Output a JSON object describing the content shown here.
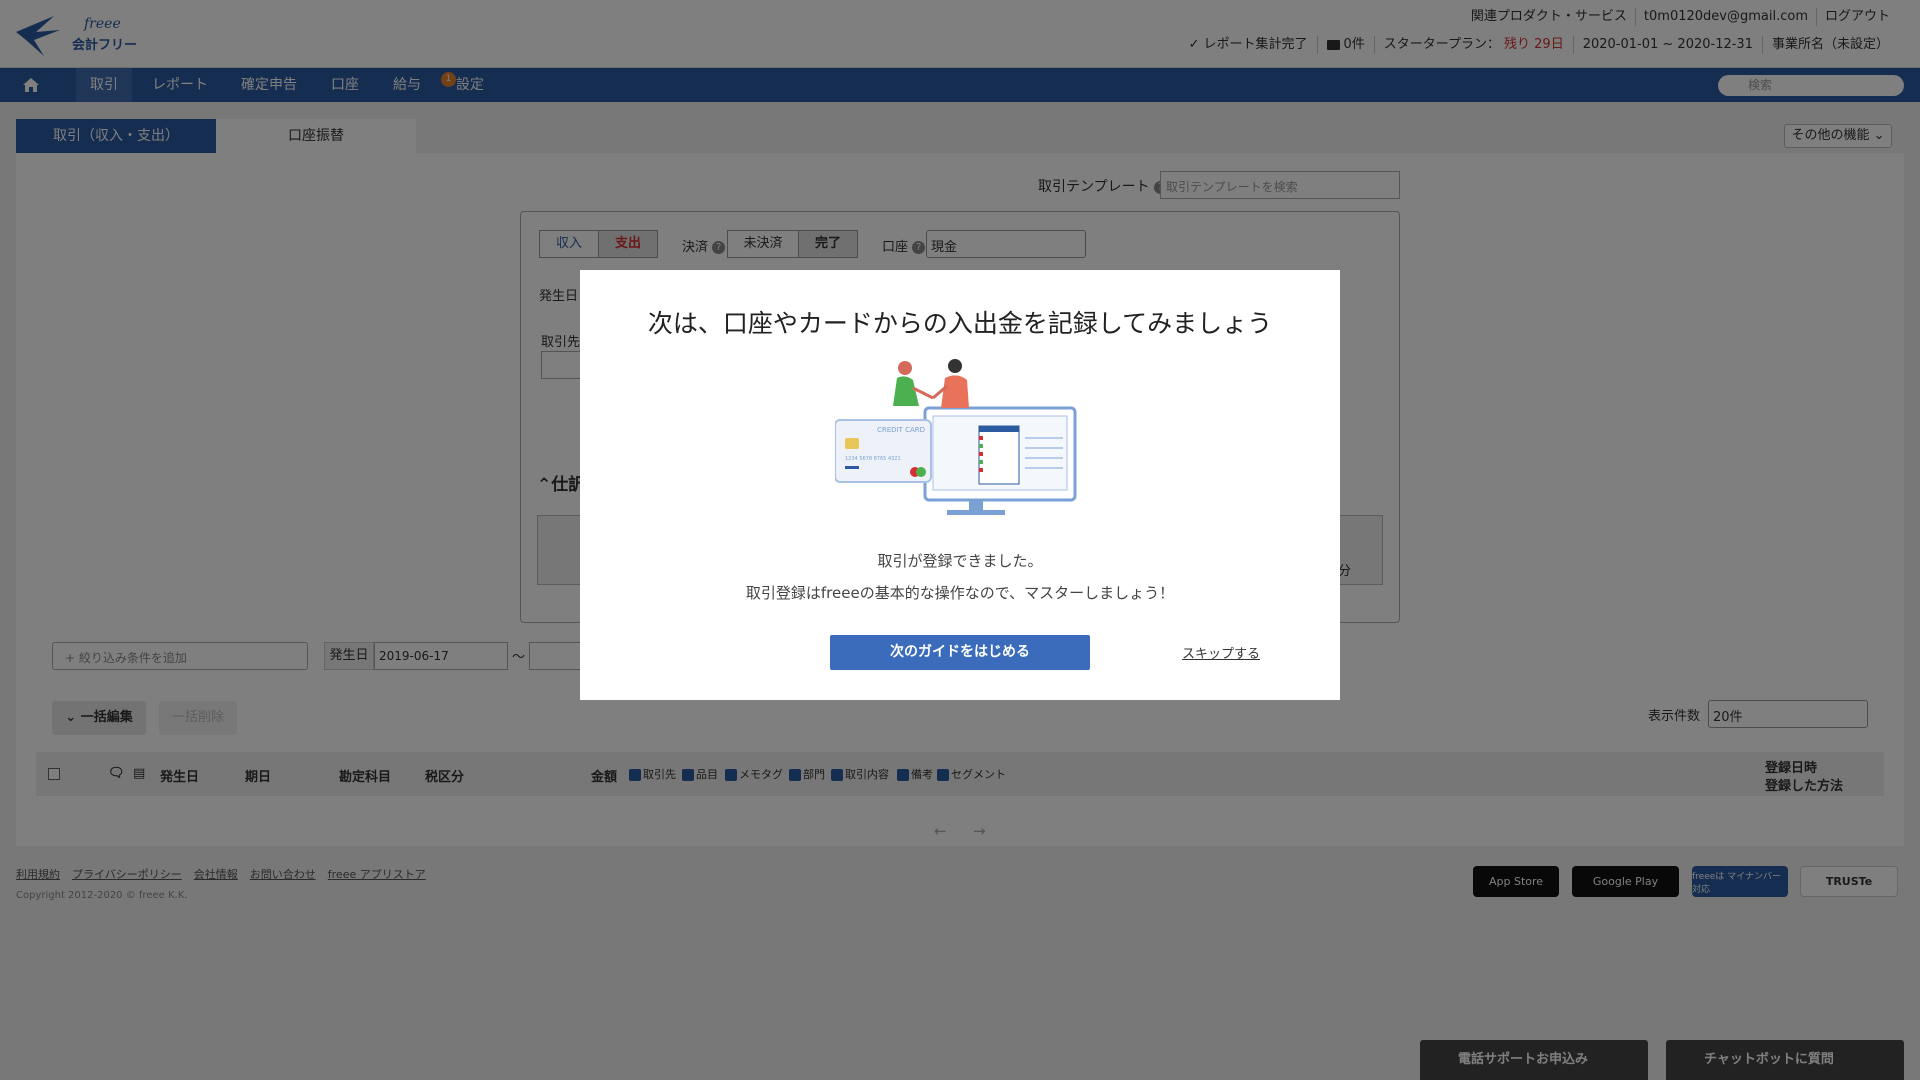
{
  "header": {
    "logo_script": "freee",
    "logo_text": "会計フリー",
    "top_links": [
      "関連プロダクト・サービス",
      "t0m0120dev@gmail.com",
      "ログアウト"
    ],
    "report_status": "レポート集計完了",
    "mail_count": "0件",
    "plan_label": "スタータープラン：",
    "plan_remaining": "残り 29日",
    "period": "2020-01-01 ~ 2020-12-31",
    "office": "事業所名（未設定）"
  },
  "nav": {
    "items": [
      "取引",
      "レポート",
      "確定申告",
      "口座",
      "給与",
      "設定"
    ],
    "settings_badge": "1",
    "search_placeholder": "検索"
  },
  "tabs": {
    "tab1": "取引（収入・支出）",
    "tab2": "口座振替",
    "other_features": "その他の機能"
  },
  "form": {
    "template_label": "取引テンプレート",
    "template_placeholder": "取引テンプレートを検索",
    "income": "収入",
    "expense": "支出",
    "settlement_label": "決済",
    "unsettled": "未決済",
    "settled": "完了",
    "account_label": "口座",
    "account_value": "現金",
    "date_label": "発生日",
    "partner_label": "取引先",
    "journal_label": "仕訳",
    "tax_fragment": "分"
  },
  "filters": {
    "add_condition": "+ 絞り込み条件を追加",
    "date_label": "発生日",
    "date_from": "2019-06-17",
    "tilde": "〜"
  },
  "list": {
    "bulk_edit": "一括編集",
    "bulk_delete": "一括削除",
    "count_label": "表示件数",
    "count_value": "20件",
    "columns": [
      "発生日",
      "期日",
      "勘定科目",
      "税区分",
      "金額"
    ],
    "checkboxes": [
      "取引先",
      "品目",
      "メモタグ",
      "部門",
      "取引内容",
      "備考",
      "セグメント"
    ],
    "reg_date": "登録日時",
    "reg_method": "登録した方法",
    "prev": "←",
    "next": "→"
  },
  "footer": {
    "links": [
      "利用規約",
      "プライバシーポリシー",
      "会社情報",
      "お問い合わせ",
      "freee アプリストア"
    ],
    "copyright": "Copyright 2012-2020 © freee K.K.",
    "badges": [
      "App Store",
      "Google Play",
      "freeeは マイナンバー対応",
      "TRUSTe"
    ]
  },
  "support": {
    "phone": "電話サポートお申込み",
    "chat": "チャットボットに質問"
  },
  "modal": {
    "title": "次は、口座やカードからの入出金を記録してみましょう",
    "illus_card_label": "CREDIT CARD",
    "illus_card_number": "1234 5678 8765 4321",
    "line1": "取引が登録できました。",
    "line2": "取引登録はfreeeの基本的な操作なので、マスターしましょう！",
    "primary_button": "次のガイドをはじめる",
    "skip": "スキップする"
  },
  "colors": {
    "brand": "#2b5aa1",
    "primary_button": "#3a6cbb",
    "remaining_days": "#d43030",
    "badge": "#e6832a"
  }
}
